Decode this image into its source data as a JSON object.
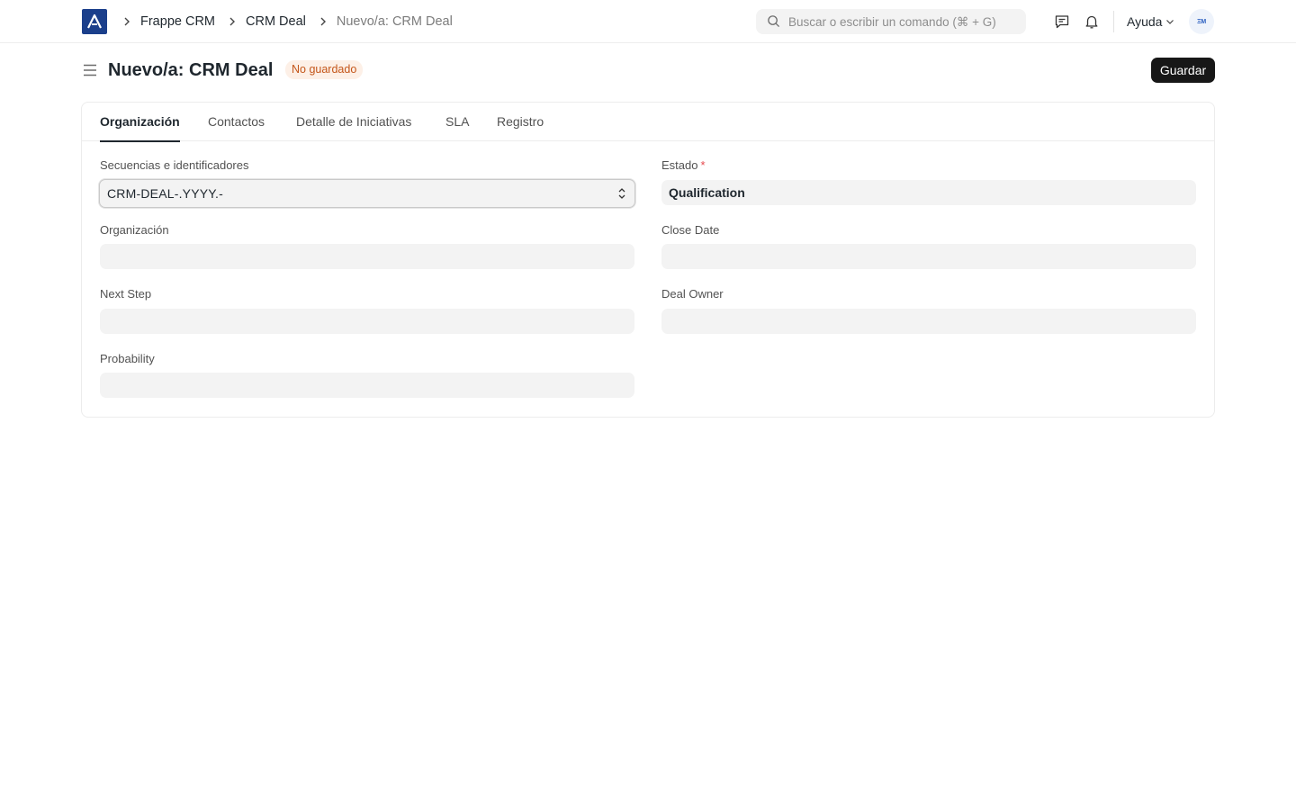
{
  "navbar": {
    "breadcrumbs": [
      "Frappe CRM",
      "CRM Deal",
      "Nuevo/a: CRM Deal"
    ],
    "search_placeholder": "Buscar o escribir un comando (⌘ + G)",
    "help_label": "Ayuda",
    "avatar_text": "ΞM",
    "icons": [
      "app-logo-icon",
      "chevron-right-icon",
      "search-icon",
      "chat-icon",
      "bell-icon",
      "chevron-down-icon"
    ]
  },
  "page": {
    "title": "Nuevo/a: CRM Deal",
    "status": "No guardado",
    "save_label": "Guardar"
  },
  "tabs": [
    {
      "label": "Organización",
      "active": true
    },
    {
      "label": "Contactos",
      "active": false
    },
    {
      "label": "Detalle de Iniciativas",
      "active": false
    },
    {
      "label": "SLA",
      "active": false
    },
    {
      "label": "Registro",
      "active": false
    }
  ],
  "form": {
    "naming_series": {
      "label": "Secuencias e identificadores",
      "value": "CRM-DEAL-.YYYY.-"
    },
    "status": {
      "label": "Estado",
      "required_mark": "*",
      "value": "Qualification"
    },
    "organization": {
      "label": "Organización",
      "value": ""
    },
    "close_date": {
      "label": "Close Date",
      "value": ""
    },
    "next_step": {
      "label": "Next Step",
      "value": ""
    },
    "deal_owner": {
      "label": "Deal Owner",
      "value": ""
    },
    "probability": {
      "label": "Probability",
      "value": ""
    }
  },
  "colors": {
    "logo_bg": "#1b3f8b",
    "badge_bg": "#fdf0e7",
    "badge_text": "#c4561a",
    "primary_button": "#171717",
    "required": "#e5484d"
  }
}
